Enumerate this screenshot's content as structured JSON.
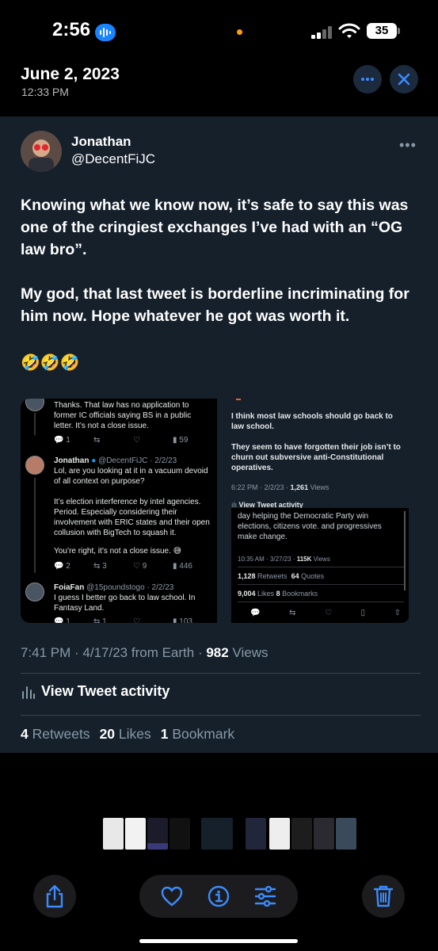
{
  "status": {
    "time": "2:56",
    "battery": "35"
  },
  "header": {
    "date": "June 2, 2023",
    "time": "12:33 PM"
  },
  "tweet": {
    "name": "Jonathan",
    "handle": "@DecentFiJC",
    "para1": "Knowing what we know now, it’s safe to say this was one of the cringiest exchanges I’ve had with an “OG law bro”.",
    "para2": "My god, that last tweet is borderline incriminating for him now. Hope whatever he got was worth it.",
    "emojis": "🤣🤣🤣",
    "meta_time": "7:41 PM · 4/17/23 from Earth · ",
    "meta_views_num": "982",
    "meta_views_label": " Views",
    "activity_label": "View Tweet activity",
    "retweets_num": "4",
    "retweets_label": "Retweets",
    "likes_num": "20",
    "likes_label": "Likes",
    "bookmarks_num": "1",
    "bookmarks_label": "Bookmark"
  },
  "media_left": {
    "reply1_text": "Thanks. That law has no application to former IC officials saying BS in a public letter. It’s not a close issue.",
    "reply1_stats": [
      "1",
      "",
      "",
      "59"
    ],
    "reply2_name": "Jonathan",
    "reply2_meta": "@DecentFiJC · 2/2/23",
    "reply2_text1": "Lol, are you looking at it in a vacuum devoid of all context on purpose?",
    "reply2_text2": "It’s election interference by intel agencies. Period. Especially considering their involvement with ERIC states and their open collusion with BigTech to squash it.",
    "reply2_text3": "You’re right, it’s not a close issue. 😅",
    "reply2_stats": [
      "2",
      "3",
      "9",
      "446"
    ],
    "reply3_name": "FoiaFan",
    "reply3_meta": "@15poundstogo · 2/2/23",
    "reply3_text": "I guess I better go back to law school. In Fantasy Land.",
    "reply3_stats": [
      "1",
      "1",
      "",
      "103"
    ]
  },
  "media_right": {
    "quote_text1": "I think most law schools should go back to law school.",
    "quote_text2": "They seem to have forgotten their job isn’t to churn out subversive anti-Constitutional operatives.",
    "quote_meta": "6:22 PM · 2/2/23 · ",
    "quote_views": "1,261",
    "quote_views_label": " Views",
    "activity_label": "View Tweet activity",
    "inner_text": "day helping the Democratic Party win elections, citizens vote. and progressives make change.",
    "inner_meta": "10:35 AM · 3/27/23 · ",
    "inner_views": "115K",
    "inner_views_label": " Views",
    "inner_retweets": "1,128",
    "inner_retweets_label": " Retweets",
    "inner_quotes": "64",
    "inner_quotes_label": " Quotes",
    "inner_likes": "9,004",
    "inner_likes_label": " Likes",
    "inner_bookmarks": "8",
    "inner_bookmarks_label": " Bookmarks"
  },
  "icons": {
    "share": "share-icon",
    "heart": "heart-icon",
    "info": "info-icon",
    "adjust": "adjust-icon",
    "trash": "trash-icon",
    "more": "more-icon",
    "close": "close-icon"
  },
  "colors": {
    "accent": "#3b8cff",
    "tweet_bg": "#15202b",
    "muted": "#8899a6"
  }
}
